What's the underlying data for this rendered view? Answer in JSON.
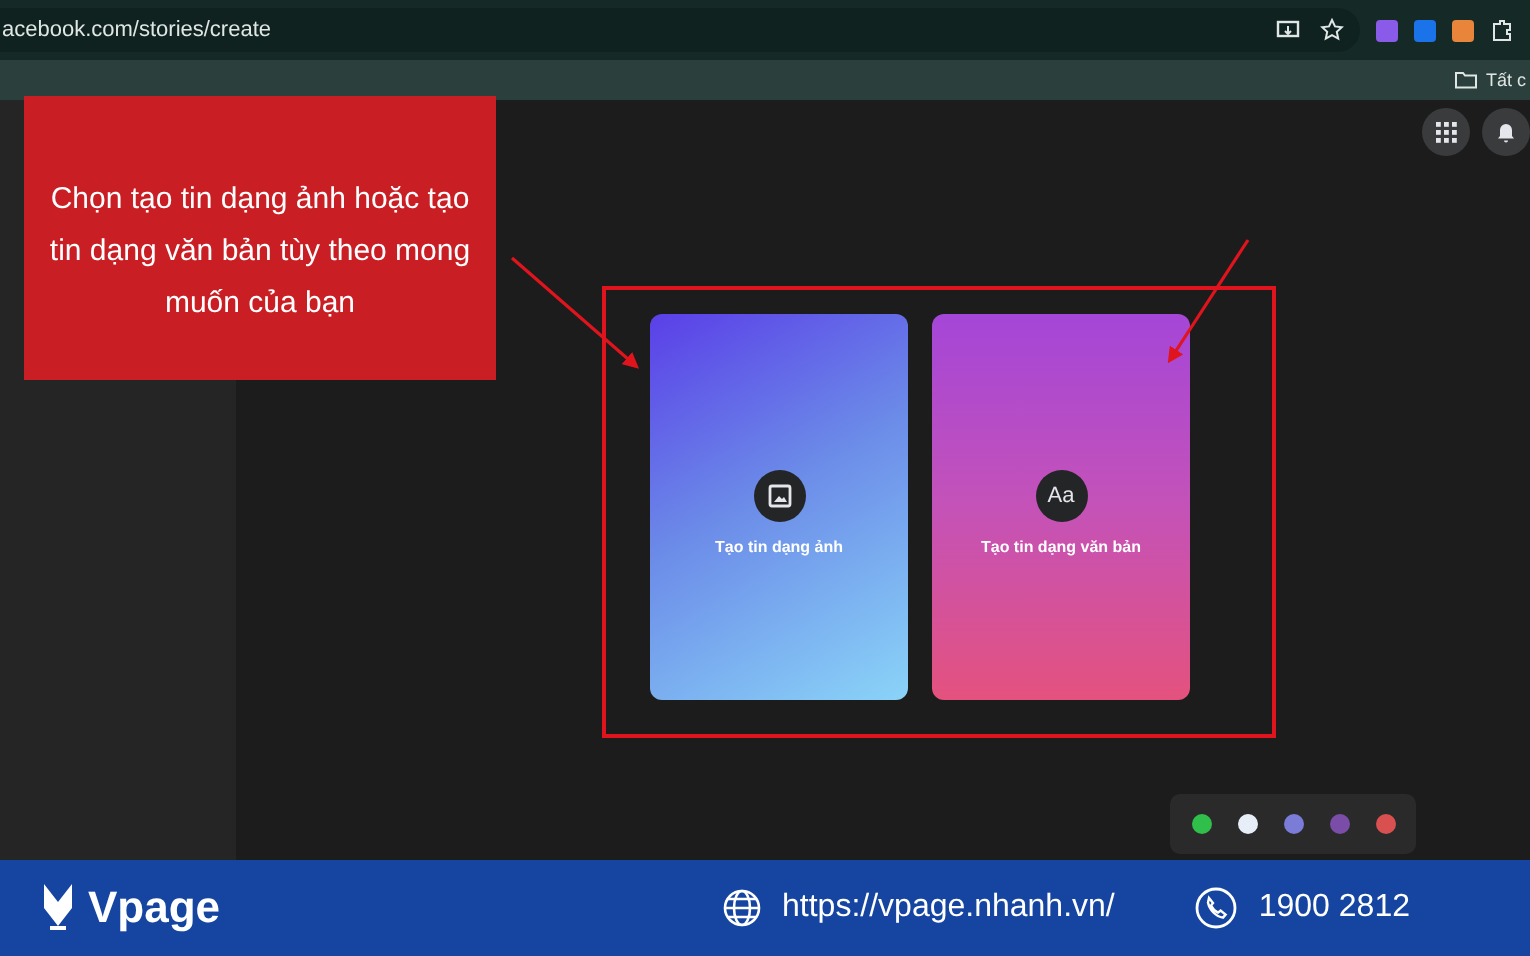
{
  "browser": {
    "url": "acebook.com/stories/create",
    "bookmark": "Tất c"
  },
  "annotation": {
    "text": "Chọn tạo tin dạng ảnh hoặc tạo tin dạng văn bản tùy theo mong muốn của bạn"
  },
  "cards": [
    {
      "kind": "photo",
      "label": "Tạo tin dạng ảnh"
    },
    {
      "kind": "text",
      "label": "Tạo tin dạng văn bản",
      "icon_text": "Aa"
    }
  ],
  "footer": {
    "brand": "Vpage",
    "website": "https://vpage.nhanh.vn/",
    "phone": "1900 2812"
  }
}
